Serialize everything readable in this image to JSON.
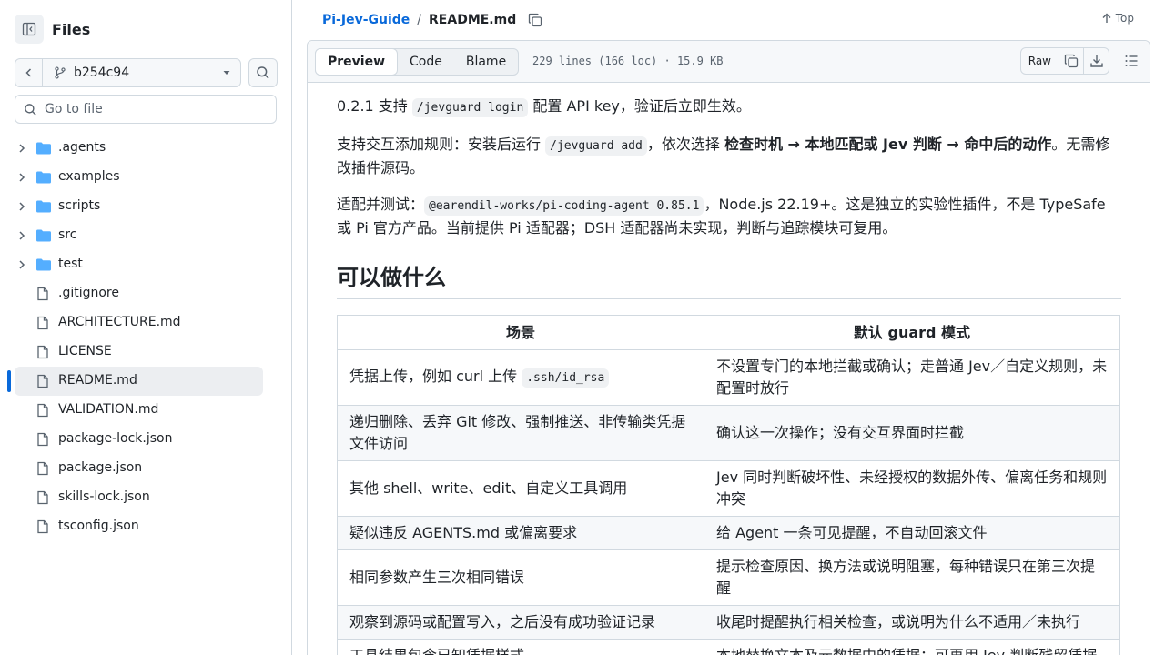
{
  "sidebar": {
    "title": "Files",
    "branch": "b254c94",
    "goto_placeholder": "Go to file",
    "items": [
      {
        "type": "folder",
        "name": ".agents"
      },
      {
        "type": "folder",
        "name": "examples"
      },
      {
        "type": "folder",
        "name": "scripts"
      },
      {
        "type": "folder",
        "name": "src"
      },
      {
        "type": "folder",
        "name": "test"
      },
      {
        "type": "file",
        "name": ".gitignore"
      },
      {
        "type": "file",
        "name": "ARCHITECTURE.md"
      },
      {
        "type": "file",
        "name": "LICENSE"
      },
      {
        "type": "file",
        "name": "README.md",
        "selected": true
      },
      {
        "type": "file",
        "name": "VALIDATION.md"
      },
      {
        "type": "file",
        "name": "package-lock.json"
      },
      {
        "type": "file",
        "name": "package.json"
      },
      {
        "type": "file",
        "name": "skills-lock.json"
      },
      {
        "type": "file",
        "name": "tsconfig.json"
      }
    ]
  },
  "breadcrumb": {
    "repo": "Pi-Jev-Guide",
    "sep": "/",
    "file": "README.md",
    "top": "Top"
  },
  "file_header": {
    "tabs": [
      "Preview",
      "Code",
      "Blame"
    ],
    "active_tab": "Preview",
    "meta": "229 lines (166 loc) · 15.9 KB",
    "raw": "Raw"
  },
  "readme": {
    "p1": {
      "a": "0.2.1 支持 ",
      "code": "/jevguard login",
      "b": " 配置 API key，验证后立即生效。"
    },
    "p2": {
      "a": "支持交互添加规则：安装后运行 ",
      "code": "/jevguard add",
      "b": "，依次选择 ",
      "strong": "检查时机 → 本地匹配或 Jev 判断 → 命中后的动作",
      "c": "。无需修改插件源码。"
    },
    "p3": {
      "a": "适配并测试：",
      "code": "@earendil-works/pi-coding-agent 0.85.1",
      "b": "，Node.js 22.19+。这是独立的实验性插件，不是 TypeSafe 或 Pi 官方产品。当前提供 Pi 适配器；DSH 适配器尚未实现，判断与追踪模块可复用。"
    },
    "h2": "可以做什么",
    "table": {
      "headers": [
        "场景",
        "默认 guard 模式"
      ],
      "rows": [
        {
          "c1a": "凭据上传，例如 curl 上传 ",
          "c1code": ".ssh/id_rsa",
          "c2": "不设置专门的本地拦截或确认；走普通 Jev／自定义规则，未配置时放行"
        },
        {
          "c1a": "递归删除、丢弃 Git 修改、强制推送、非传输类凭据文件访问",
          "c1code": "",
          "c2": "确认这一次操作；没有交互界面时拦截"
        },
        {
          "c1a": "其他 shell、write、edit、自定义工具调用",
          "c1code": "",
          "c2": "Jev 同时判断破坏性、未经授权的数据外传、偏离任务和规则冲突"
        },
        {
          "c1a": "疑似违反 AGENTS.md 或偏离要求",
          "c1code": "",
          "c2": "给 Agent 一条可见提醒，不自动回滚文件"
        },
        {
          "c1a": "相同参数产生三次相同错误",
          "c1code": "",
          "c2": "提示检查原因、换方法或说明阻塞，每种错误只在第三次提醒"
        },
        {
          "c1a": "观察到源码或配置写入，之后没有成功验证记录",
          "c1code": "",
          "c2": "收尾时提醒执行相关检查，或说明为什么不适用／未执行"
        },
        {
          "c1a": "工具结果包含已知凭据样式",
          "c1code": "",
          "c2": "本地替换文本及元数据中的凭据；可再用 Jev 判断残留凭据"
        }
      ]
    }
  },
  "colors": {
    "accent": "#0969da",
    "folder": "#54aeff",
    "border": "#d1d9e0",
    "muted": "#59636e"
  }
}
